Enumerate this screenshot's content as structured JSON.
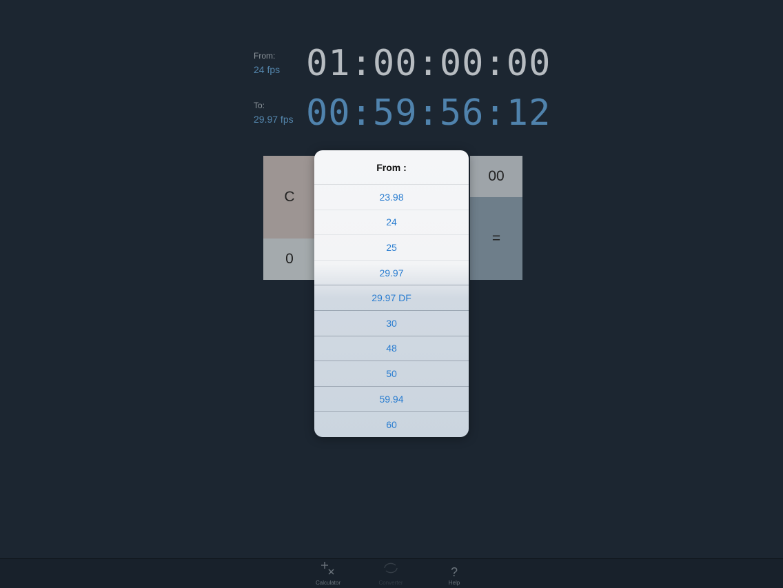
{
  "display": {
    "from_label": "From:",
    "from_fps": "24 fps",
    "from_timecode": "01:00:00:00",
    "to_label": "To:",
    "to_fps": "29.97 fps",
    "to_timecode": "00:59:56:12"
  },
  "keypad": {
    "clear": "C",
    "zero": "0",
    "double_zero": "00",
    "equals": "="
  },
  "popover": {
    "title": "From :",
    "options": [
      "23.98",
      "24",
      "25",
      "29.97",
      "29.97 DF",
      "30",
      "48",
      "50",
      "59.94",
      "60"
    ]
  },
  "tabbar": {
    "tabs": [
      {
        "label": "Calculator",
        "icon": "plus-times-icon"
      },
      {
        "label": "Converter",
        "icon": "converter-icon"
      },
      {
        "label": "Help",
        "icon": "question-icon"
      }
    ]
  },
  "colors": {
    "background": "#1c2631",
    "accent_blue": "#5083ad",
    "option_blue": "#2a7dd0"
  }
}
